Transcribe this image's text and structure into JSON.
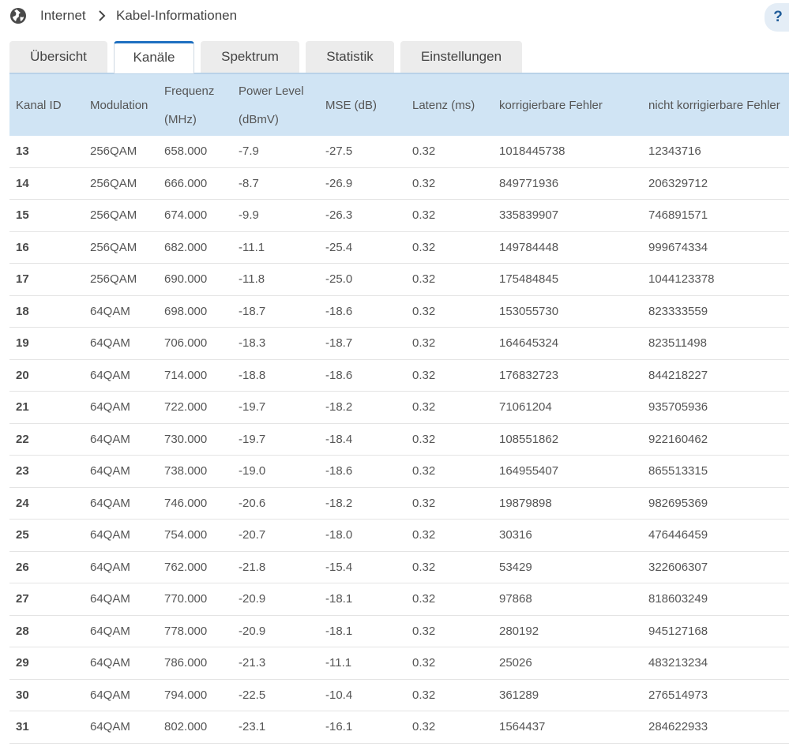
{
  "header": {
    "breadcrumb_root": "Internet",
    "breadcrumb_current": "Kabel-Informationen",
    "help_label": "?"
  },
  "tabs": [
    {
      "label": "Übersicht",
      "active": false
    },
    {
      "label": "Kanäle",
      "active": true
    },
    {
      "label": "Spektrum",
      "active": false
    },
    {
      "label": "Statistik",
      "active": false
    },
    {
      "label": "Einstellungen",
      "active": false
    }
  ],
  "table": {
    "columns": [
      {
        "line1": "Kanal ID",
        "line2": ""
      },
      {
        "line1": "Modulation",
        "line2": ""
      },
      {
        "line1": "Frequenz",
        "line2": "(MHz)"
      },
      {
        "line1": "Power Level",
        "line2": "(dBmV)"
      },
      {
        "line1": "MSE (dB)",
        "line2": ""
      },
      {
        "line1": "Latenz (ms)",
        "line2": ""
      },
      {
        "line1": "korrigierbare Fehler",
        "line2": ""
      },
      {
        "line1": "nicht korrigierbare Fehler",
        "line2": ""
      }
    ],
    "rows": [
      [
        "13",
        "256QAM",
        "658.000",
        "-7.9",
        "-27.5",
        "0.32",
        "1018445738",
        "12343716"
      ],
      [
        "14",
        "256QAM",
        "666.000",
        "-8.7",
        "-26.9",
        "0.32",
        "849771936",
        "206329712"
      ],
      [
        "15",
        "256QAM",
        "674.000",
        "-9.9",
        "-26.3",
        "0.32",
        "335839907",
        "746891571"
      ],
      [
        "16",
        "256QAM",
        "682.000",
        "-11.1",
        "-25.4",
        "0.32",
        "149784448",
        "999674334"
      ],
      [
        "17",
        "256QAM",
        "690.000",
        "-11.8",
        "-25.0",
        "0.32",
        "175484845",
        "1044123378"
      ],
      [
        "18",
        "64QAM",
        "698.000",
        "-18.7",
        "-18.6",
        "0.32",
        "153055730",
        "823333559"
      ],
      [
        "19",
        "64QAM",
        "706.000",
        "-18.3",
        "-18.7",
        "0.32",
        "164645324",
        "823511498"
      ],
      [
        "20",
        "64QAM",
        "714.000",
        "-18.8",
        "-18.6",
        "0.32",
        "176832723",
        "844218227"
      ],
      [
        "21",
        "64QAM",
        "722.000",
        "-19.7",
        "-18.2",
        "0.32",
        "71061204",
        "935705936"
      ],
      [
        "22",
        "64QAM",
        "730.000",
        "-19.7",
        "-18.4",
        "0.32",
        "108551862",
        "922160462"
      ],
      [
        "23",
        "64QAM",
        "738.000",
        "-19.0",
        "-18.6",
        "0.32",
        "164955407",
        "865513315"
      ],
      [
        "24",
        "64QAM",
        "746.000",
        "-20.6",
        "-18.2",
        "0.32",
        "19879898",
        "982695369"
      ],
      [
        "25",
        "64QAM",
        "754.000",
        "-20.7",
        "-18.0",
        "0.32",
        "30316",
        "476446459"
      ],
      [
        "26",
        "64QAM",
        "762.000",
        "-21.8",
        "-15.4",
        "0.32",
        "53429",
        "322606307"
      ],
      [
        "27",
        "64QAM",
        "770.000",
        "-20.9",
        "-18.1",
        "0.32",
        "97868",
        "818603249"
      ],
      [
        "28",
        "64QAM",
        "778.000",
        "-20.9",
        "-18.1",
        "0.32",
        "280192",
        "945127168"
      ],
      [
        "29",
        "64QAM",
        "786.000",
        "-21.3",
        "-11.1",
        "0.32",
        "25026",
        "483213234"
      ],
      [
        "30",
        "64QAM",
        "794.000",
        "-22.5",
        "-10.4",
        "0.32",
        "361289",
        "276514973"
      ],
      [
        "31",
        "64QAM",
        "802.000",
        "-23.1",
        "-16.1",
        "0.32",
        "1564437",
        "284622933"
      ]
    ]
  },
  "colors": {
    "header_bg": "#d0e4f4",
    "accent": "#1f70c1",
    "tab_bg": "#ececec"
  }
}
